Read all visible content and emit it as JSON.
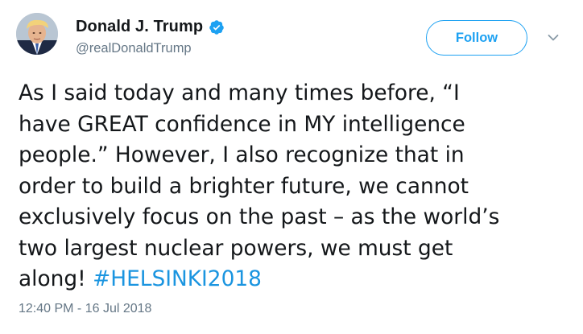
{
  "author": {
    "name": "Donald J. Trump",
    "handle": "@realDonaldTrump",
    "verified": true,
    "avatar_icon": "profile-photo"
  },
  "actions": {
    "follow_label": "Follow",
    "more_icon": "chevron-down-icon"
  },
  "tweet": {
    "lines": [
      "As I said today and many times before, “I",
      "have GREAT confidence in MY intelligence",
      "people.” However, I also recognize that in",
      "order to build a brighter future, we cannot",
      "exclusively focus on the past – as the world’s",
      "two largest nuclear powers, we must get",
      "along! "
    ],
    "hashtag": "#HELSINKI2018",
    "timestamp": "12:40 PM - 16 Jul 2018"
  },
  "colors": {
    "link_blue": "#1b95e0",
    "follow_blue": "#1da1f2",
    "secondary_text": "#657786",
    "primary_text": "#14171a"
  }
}
